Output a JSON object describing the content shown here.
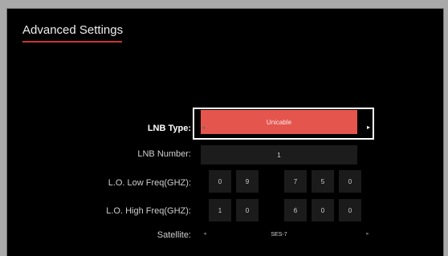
{
  "page": {
    "title": "Advanced Settings"
  },
  "lnb_type": {
    "label": "LNB Type:",
    "value": "Unicable"
  },
  "lnb_number": {
    "label": "LNB Number:",
    "value": "1"
  },
  "lo_low": {
    "label": "L.O. Low Freq(GHZ):",
    "digits": [
      "0",
      "9",
      "7",
      "5",
      "0"
    ]
  },
  "lo_high": {
    "label": "L.O. High Freq(GHZ):",
    "digits": [
      "1",
      "0",
      "6",
      "0",
      "0"
    ]
  },
  "satellite": {
    "label": "Satellite:",
    "value": "SES-7"
  },
  "colors": {
    "accent": "#e4554e",
    "underline": "#c8352e"
  },
  "icons": {
    "arrow_left": "chevron-left-icon",
    "arrow_right": "chevron-right-icon"
  }
}
